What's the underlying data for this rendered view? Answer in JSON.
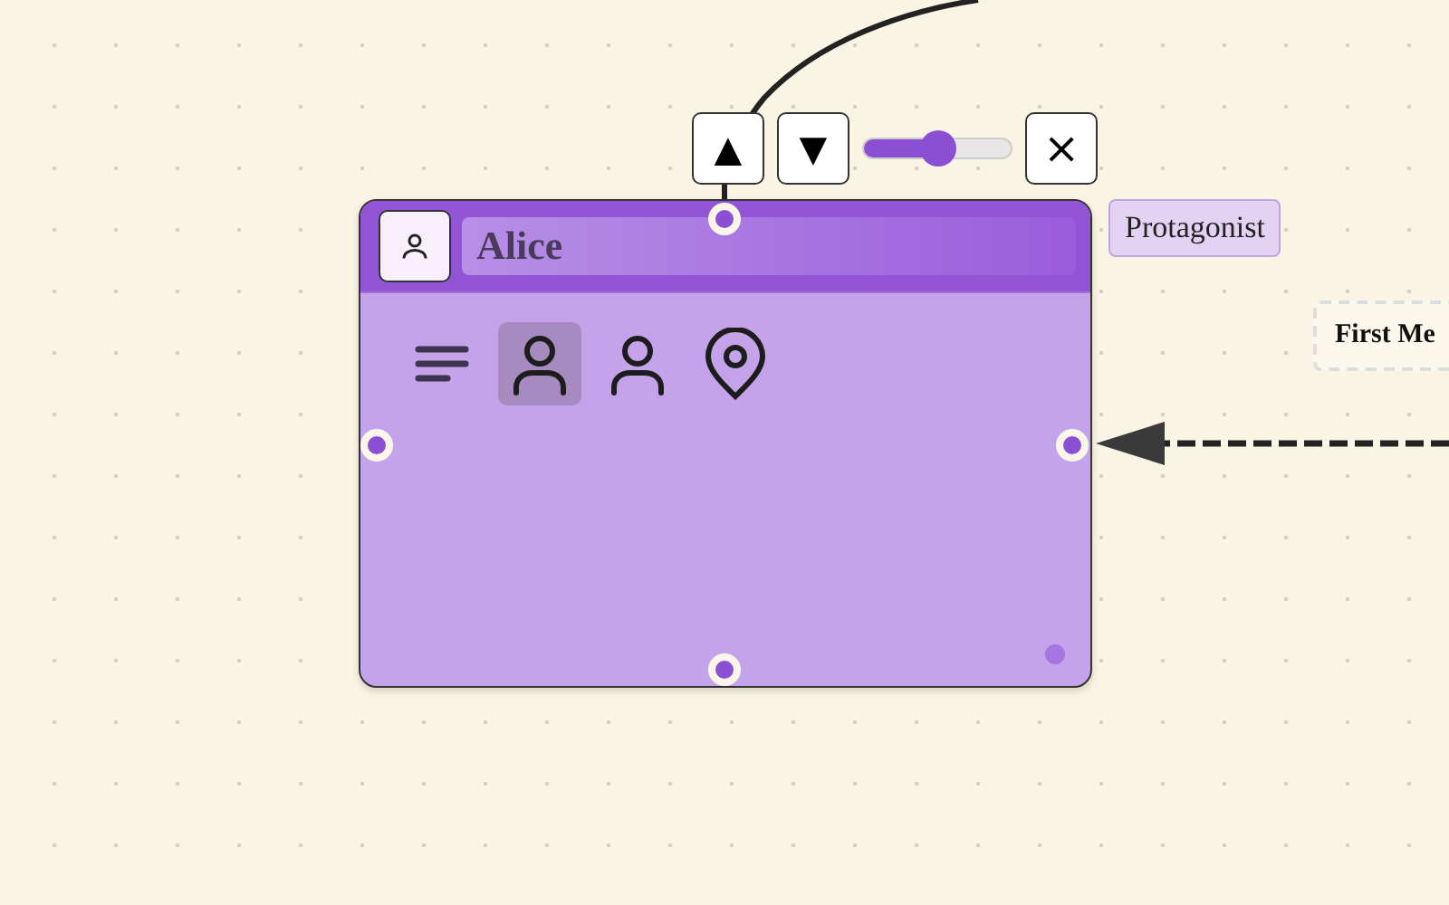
{
  "toolbar": {
    "buttons": [
      {
        "label": "▲"
      },
      {
        "label": "▼"
      }
    ],
    "slider": {
      "level": 0.5
    },
    "close": "×"
  },
  "node": {
    "title": "Alice",
    "tabs": [
      {
        "kind": "lines",
        "selected": false
      },
      {
        "kind": "person",
        "selected": true
      },
      {
        "kind": "person",
        "selected": false
      },
      {
        "kind": "pin",
        "selected": false
      }
    ]
  },
  "tag": "Protagonist",
  "edge_label": "First Me"
}
